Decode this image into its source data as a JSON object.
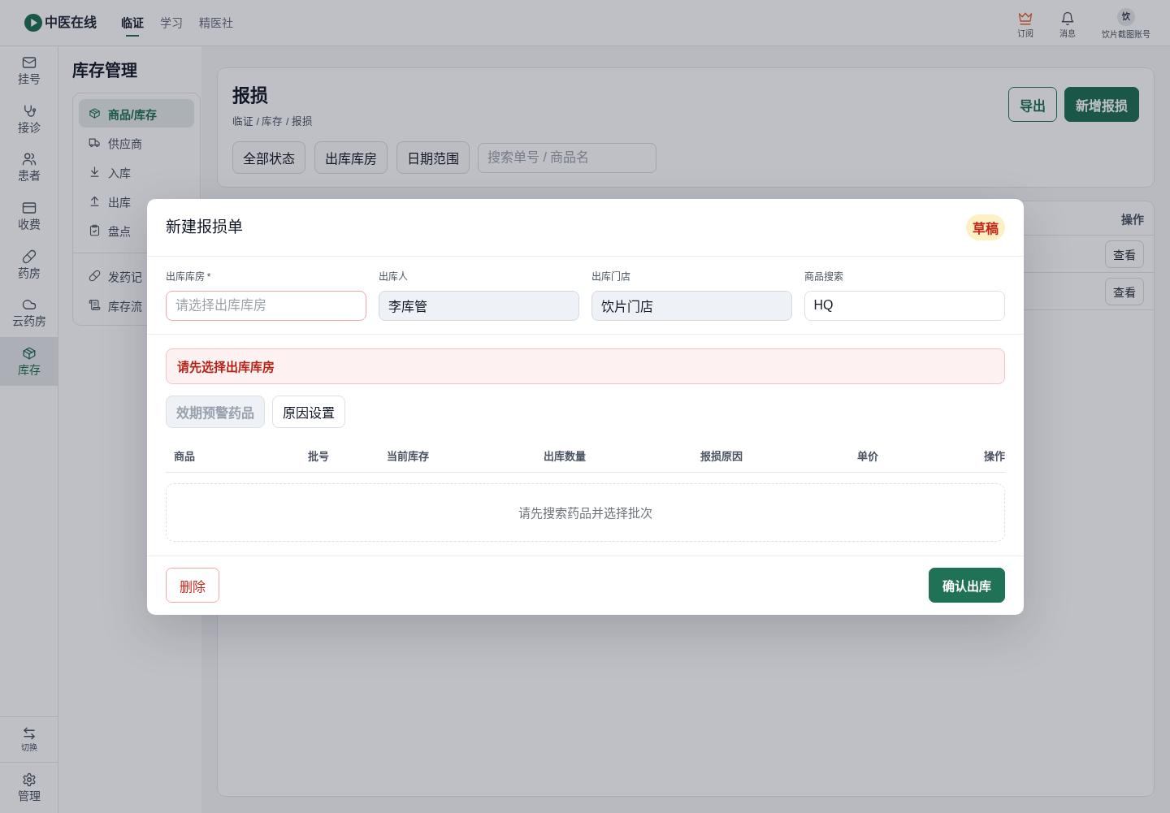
{
  "topbar": {
    "brand": "中医在线",
    "nav": [
      {
        "label": "临证",
        "selected": true
      },
      {
        "label": "学习",
        "selected": false
      },
      {
        "label": "精医社",
        "selected": false
      }
    ],
    "actions": [
      {
        "label": "订阅"
      },
      {
        "label": "消息"
      }
    ],
    "account": {
      "avatar": "饮",
      "name": "饮片截图账号"
    }
  },
  "rail": {
    "items": [
      {
        "label": "挂号",
        "selected": false
      },
      {
        "label": "接诊",
        "selected": false
      },
      {
        "label": "患者",
        "selected": false
      },
      {
        "label": "收费",
        "selected": false
      },
      {
        "label": "药房",
        "selected": false
      },
      {
        "label": "云药房",
        "selected": false
      },
      {
        "label": "库存",
        "selected": true
      }
    ],
    "bottom": [
      {
        "label": "切换"
      },
      {
        "label": "管理"
      }
    ]
  },
  "sidebar": {
    "title": "库存管理",
    "groups": [
      {
        "items": [
          {
            "label": "商品/库存",
            "selected": true
          },
          {
            "label": "供应商",
            "selected": false
          },
          {
            "label": "入库",
            "selected": false
          },
          {
            "label": "出库",
            "selected": false
          },
          {
            "label": "盘点",
            "selected": false
          }
        ]
      },
      {
        "items": [
          {
            "label": "发药记",
            "selected": false
          },
          {
            "label": "库存流",
            "selected": false
          }
        ]
      }
    ]
  },
  "page": {
    "title": "报损",
    "breadcrumb": "临证 / 库存 / 报损",
    "filters": [
      {
        "label": "全部状态"
      },
      {
        "label": "出库库房"
      },
      {
        "label": "日期范围"
      }
    ],
    "search": {
      "placeholder": "搜索单号 / 商品名"
    },
    "actions": [
      {
        "kind": "outline",
        "label": "导出"
      },
      {
        "kind": "primary",
        "label": "新增报损"
      }
    ],
    "table": {
      "column": "操作",
      "rows": [
        {
          "action": "查看"
        },
        {
          "action": "查看"
        }
      ]
    }
  },
  "dialog": {
    "title": "新建报损单",
    "status": "草稿",
    "fields": [
      {
        "label": "出库库房 *",
        "placeholder": "请选择出库库房",
        "invalid": true,
        "readonly": false
      },
      {
        "label": "出库人",
        "value": "李库管",
        "invalid": false,
        "readonly": true
      },
      {
        "label": "出库门店",
        "value": "饮片门店",
        "invalid": false,
        "readonly": true
      },
      {
        "label": "商品搜索",
        "value": "HQ",
        "invalid": false,
        "readonly": false
      }
    ],
    "alert": "请先选择出库库房",
    "tools": [
      {
        "label": "效期预警药品",
        "disabled": true
      },
      {
        "label": "原因设置",
        "disabled": false
      }
    ],
    "table": {
      "columns": [
        "商品",
        "批号",
        "当前库存",
        "出库数量",
        "报损原因",
        "单价",
        "操作"
      ],
      "empty": "请先搜索药品并选择批次"
    },
    "footer": [
      {
        "kind": "danger",
        "label": "删除"
      },
      {
        "kind": "primary",
        "label": "确认出库"
      }
    ]
  }
}
